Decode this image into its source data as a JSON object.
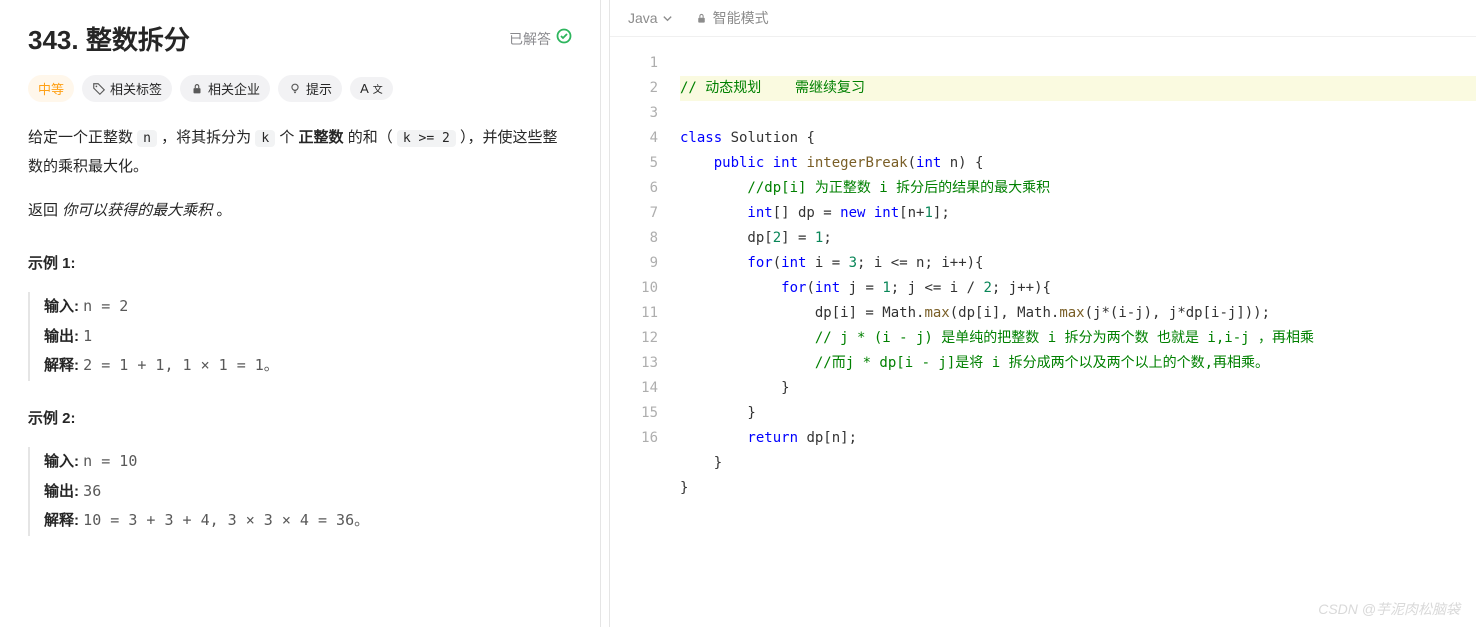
{
  "problem": {
    "title": "343. 整数拆分",
    "solved_label": "已解答",
    "difficulty": "中等",
    "tag_related": "相关标签",
    "tag_company": "相关企业",
    "tag_hint": "提示",
    "tag_font": "A"
  },
  "desc": {
    "p1_a": "给定一个正整数 ",
    "p1_n": "n",
    "p1_b": " ，将其拆分为 ",
    "p1_k": "k",
    "p1_c": " 个 ",
    "p1_bold": "正整数",
    "p1_d": " 的和（ ",
    "p1_cond": "k >= 2",
    "p1_e": " ），并使这些整数的乘积最大化。",
    "p2_a": "返回 ",
    "p2_em": "你可以获得的最大乘积",
    "p2_b": " 。"
  },
  "ex1": {
    "title": "示例 1:",
    "in_lbl": "输入: ",
    "in_val": "n = 2",
    "out_lbl": "输出: ",
    "out_val": "1",
    "exp_lbl": "解释: ",
    "exp_val": "2 = 1 + 1, 1 × 1 = 1。"
  },
  "ex2": {
    "title": "示例 2:",
    "in_lbl": "输入: ",
    "in_val": "n = 10",
    "out_lbl": "输出: ",
    "out_val": "36",
    "exp_lbl": "解释: ",
    "exp_val": "10 = 3 + 3 + 4, 3 × 3 × 4 = 36。"
  },
  "editor": {
    "lang": "Java",
    "mode": "智能模式",
    "watermark": "CSDN @芋泥肉松脑袋"
  },
  "code": {
    "lines": 16,
    "l1": "// 动态规划    需继续复习",
    "l2a": "class",
    "l2b": " Solution {",
    "l3a": "    public",
    "l3b": " int",
    "l3c": " integerBreak",
    "l3d": "(",
    "l3e": "int",
    "l3f": " n) {",
    "l4": "        //dp[i] 为正整数 i 拆分后的结果的最大乘积",
    "l5a": "        int",
    "l5b": "[] dp = ",
    "l5c": "new",
    "l5d": " int",
    "l5e": "[n+",
    "l5f": "1",
    "l5g": "];",
    "l6a": "        dp[",
    "l6b": "2",
    "l6c": "] = ",
    "l6d": "1",
    "l6e": ";",
    "l7a": "        for",
    "l7b": "(",
    "l7c": "int",
    "l7d": " i = ",
    "l7e": "3",
    "l7f": "; i <= n; i++){",
    "l8a": "            for",
    "l8b": "(",
    "l8c": "int",
    "l8d": " j = ",
    "l8e": "1",
    "l8f": "; j <= i / ",
    "l8g": "2",
    "l8h": "; j++){",
    "l9a": "                dp[i] = Math.",
    "l9b": "max",
    "l9c": "(dp[i], Math.",
    "l9d": "max",
    "l9e": "(j*(i-j), j*dp[i-j]));",
    "l10": "                // j * (i - j) 是单纯的把整数 i 拆分为两个数 也就是 i,i-j ，再相乘",
    "l11": "                //而j * dp[i - j]是将 i 拆分成两个以及两个以上的个数,再相乘。",
    "l12": "            }",
    "l13": "        }",
    "l14a": "        return",
    "l14b": " dp[n];",
    "l15": "    }",
    "l16": "}"
  }
}
